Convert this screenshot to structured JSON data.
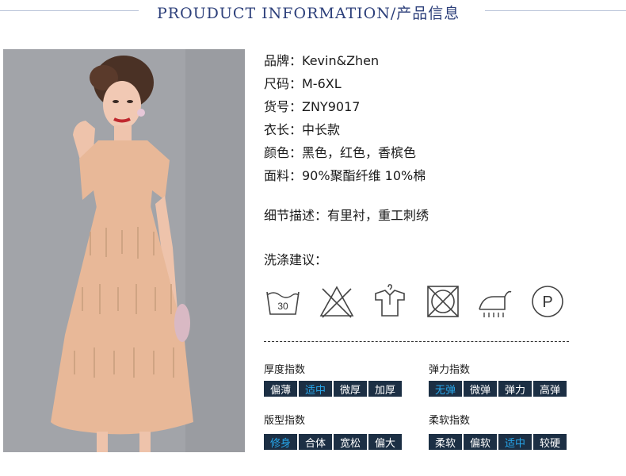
{
  "header": {
    "title": "PROUDUCT INFORMATION/产品信息"
  },
  "info": [
    "品牌：Kevin&Zhen",
    "尺码：M-6XL",
    "货号：ZNY9017",
    "衣长：中长款",
    "颜色：黑色，红色，香槟色",
    "面料：90%聚酯纤维 10%棉"
  ],
  "detail": "细节描述：有里衬，重工刺绣",
  "wash_title": "洗涤建议：",
  "wash_icons": {
    "basin_temp": "30",
    "professional_clean": "P",
    "names": [
      "wash-30-icon",
      "do-not-bleach-icon",
      "hang-dry-icon",
      "do-not-tumble-dry-icon",
      "iron-icon",
      "professional-clean-icon"
    ]
  },
  "indices": [
    {
      "title": "厚度指数",
      "options": [
        "偏薄",
        "适中",
        "微厚",
        "加厚"
      ],
      "selected": "适中"
    },
    {
      "title": "弹力指数",
      "options": [
        "无弹",
        "微弹",
        "弹力",
        "高弹"
      ],
      "selected": "无弹"
    },
    {
      "title": "版型指数",
      "options": [
        "修身",
        "合体",
        "宽松",
        "偏大"
      ],
      "selected": "修身"
    },
    {
      "title": "柔软指数",
      "options": [
        "柔软",
        "偏软",
        "适中",
        "较硬"
      ],
      "selected": "适中"
    }
  ],
  "colors": {
    "title": "#2c3f7a",
    "chip_bg": "#1c2f44",
    "chip_selected": "#27a6ea",
    "dress": "#e8b898"
  }
}
